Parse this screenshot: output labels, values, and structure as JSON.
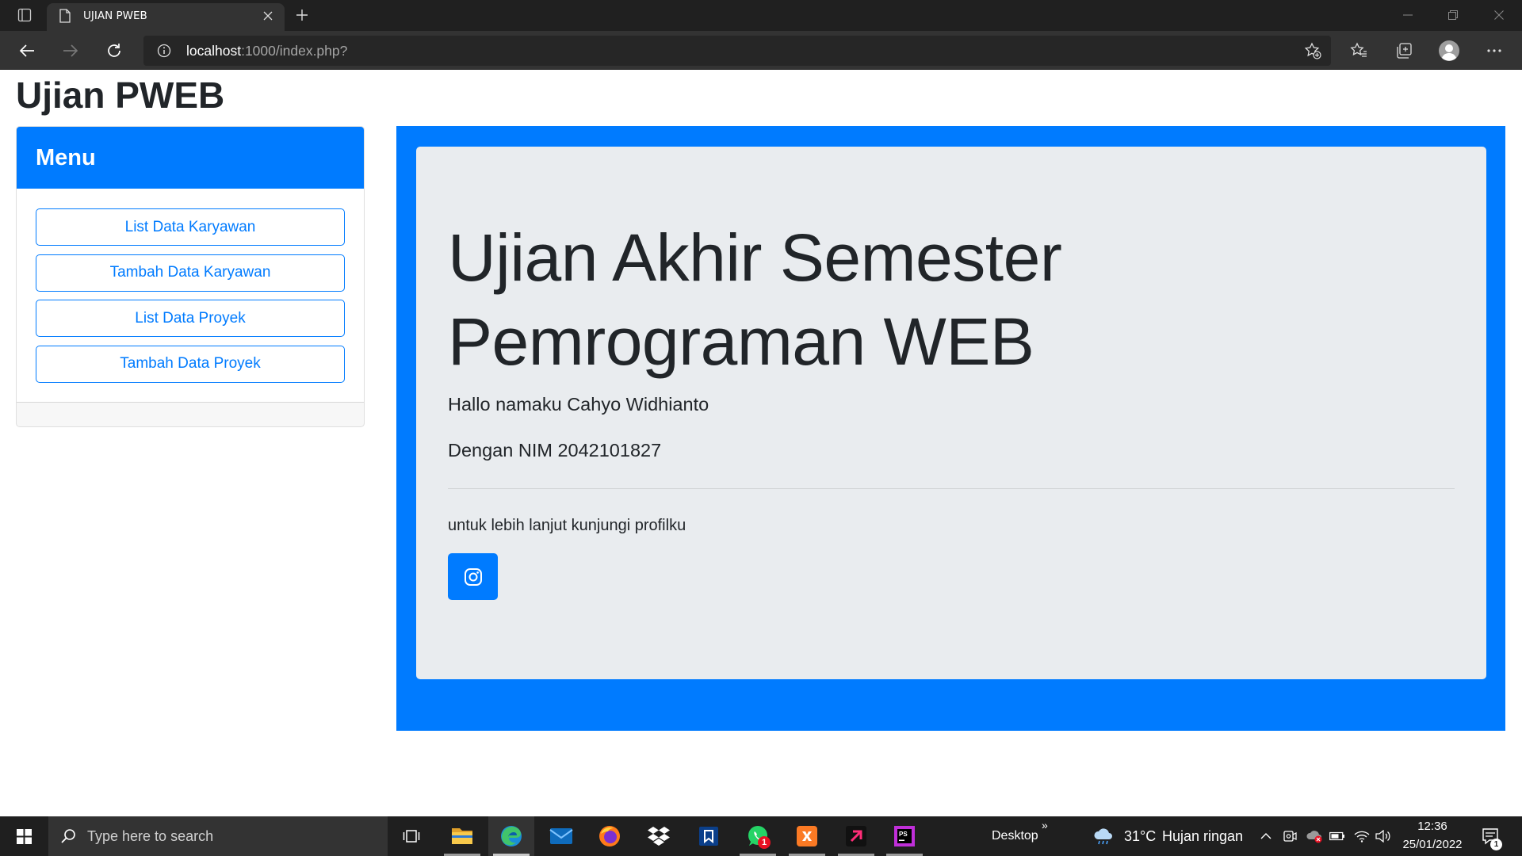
{
  "browser": {
    "tab": {
      "title": "UJIAN PWEB",
      "favicon": "page-icon"
    },
    "address": {
      "host": "localhost",
      "rest": ":1000/index.php?"
    },
    "toolbar_icons": [
      "back-arrow-icon",
      "forward-arrow-icon",
      "reload-icon",
      "info-icon",
      "add-favorite-icon",
      "favorites-icon",
      "collections-icon",
      "profile-icon",
      "more-icon"
    ],
    "window_icons": [
      "minimize-icon",
      "restore-icon",
      "close-icon"
    ]
  },
  "page": {
    "site_title": "Ujian PWEB",
    "sidebar": {
      "header": "Menu",
      "items": [
        {
          "label": "List Data Karyawan"
        },
        {
          "label": "Tambah Data Karyawan"
        },
        {
          "label": "List Data Proyek"
        },
        {
          "label": "Tambah Data Proyek"
        }
      ]
    },
    "jumbotron": {
      "heading_lines": [
        "Ujian Akhir Semester",
        "Pemrograman WEB"
      ],
      "greeting": "Hallo namaku Cahyo Widhianto",
      "nim": "Dengan NIM 2042101827",
      "cta": "untuk lebih lanjut kunjungi profilku",
      "button_icon": "instagram-icon"
    }
  },
  "taskbar": {
    "search_placeholder": "Type here to search",
    "apps": [
      {
        "icon": "file-explorer-icon",
        "running": true
      },
      {
        "icon": "edge-icon",
        "running": true,
        "active": true
      },
      {
        "icon": "mail-icon",
        "running": false
      },
      {
        "icon": "firefox-icon",
        "running": false
      },
      {
        "icon": "dropbox-icon",
        "running": false
      },
      {
        "icon": "bookmark-app-icon",
        "running": false
      },
      {
        "icon": "whatsapp-icon",
        "running": true,
        "badge": "1"
      },
      {
        "icon": "xampp-icon",
        "running": true
      },
      {
        "icon": "magenta-app-icon",
        "running": true
      },
      {
        "icon": "phpstorm-icon",
        "running": true,
        "logo_text": "PS"
      }
    ],
    "desktop_label": "Desktop",
    "desktop_chevron": "»",
    "weather": {
      "icon": "rain-cloud-icon",
      "temp": "31°C",
      "condition": "Hujan ringan"
    },
    "tray_icons": [
      "chevron-up-icon",
      "meet-now-icon",
      "onedrive-error-icon",
      "battery-icon",
      "wifi-icon",
      "volume-icon"
    ],
    "clock": {
      "time": "12:36",
      "date": "25/01/2022"
    },
    "notification_badge": "1"
  },
  "colors": {
    "primary": "#007bff",
    "jumbotron_bg": "#e9ecef",
    "text": "#212529",
    "taskbar_bg": "#1f1f1f",
    "browser_toolbar": "#333333"
  }
}
